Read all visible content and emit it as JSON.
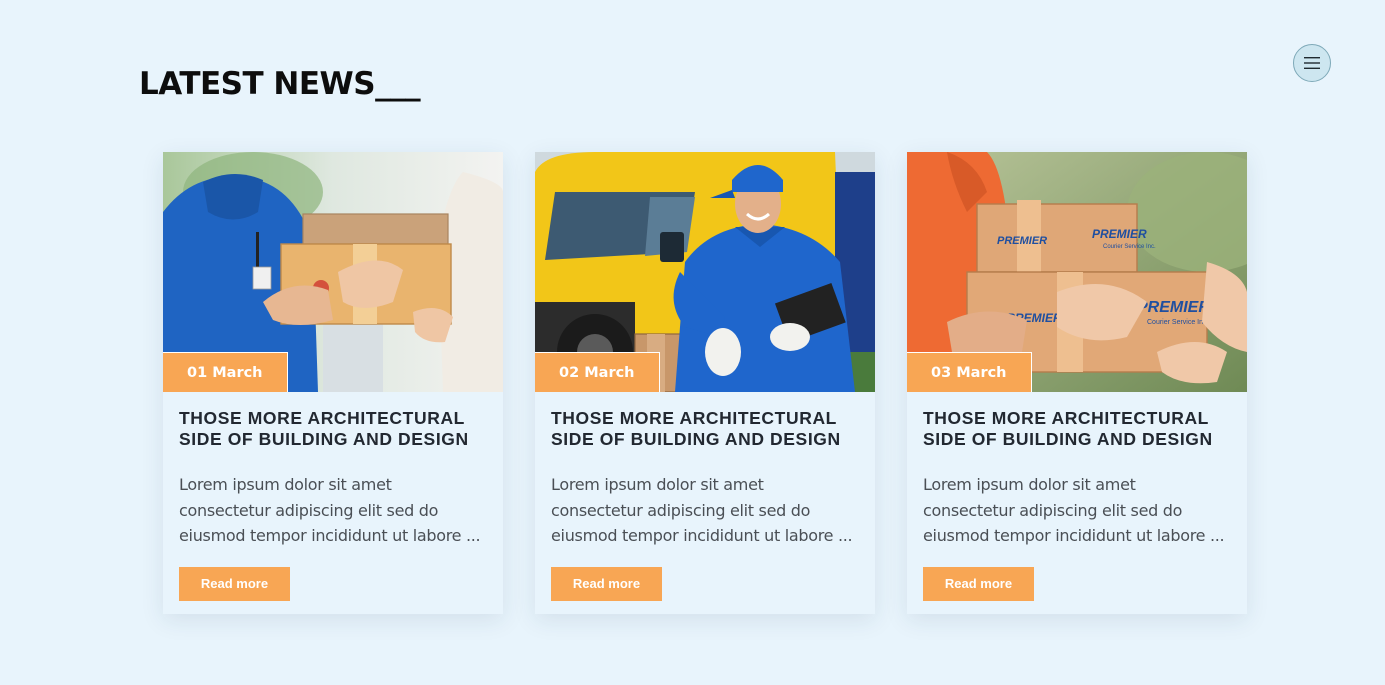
{
  "section": {
    "title": "LATEST NEWS___"
  },
  "menu": {
    "icon": "hamburger-menu-icon"
  },
  "colors": {
    "background": "#e8f4fc",
    "accent": "#f8a654",
    "title_text": "#222831",
    "body_text": "#4a4f55"
  },
  "cards": [
    {
      "date": "01 March",
      "title_line1": "THOSE MORE ARCHITECTURAL",
      "title_line2": "SIDE OF BUILDING AND DESIGN",
      "excerpt_line1": "Lorem ipsum dolor sit amet",
      "excerpt_line2": "consectetur adipiscing elit sed do",
      "excerpt_line3": "eiusmod tempor incididunt ut labore ...",
      "button": "Read more"
    },
    {
      "date": "02 March",
      "title_line1": "THOSE MORE ARCHITECTURAL",
      "title_line2": "SIDE OF BUILDING AND DESIGN",
      "excerpt_line1": "Lorem ipsum dolor sit amet",
      "excerpt_line2": "consectetur adipiscing elit sed do",
      "excerpt_line3": "eiusmod tempor incididunt ut labore ...",
      "button": "Read more"
    },
    {
      "date": "03 March",
      "title_line1": "THOSE MORE ARCHITECTURAL",
      "title_line2": "SIDE OF BUILDING AND DESIGN",
      "excerpt_line1": "Lorem ipsum dolor sit amet",
      "excerpt_line2": "consectetur adipiscing elit sed do",
      "excerpt_line3": "eiusmod tempor incididunt ut labore ...",
      "button": "Read more",
      "box_logo_text": "PREMIER",
      "box_logo_subtext": "Courier Service Inc."
    }
  ]
}
